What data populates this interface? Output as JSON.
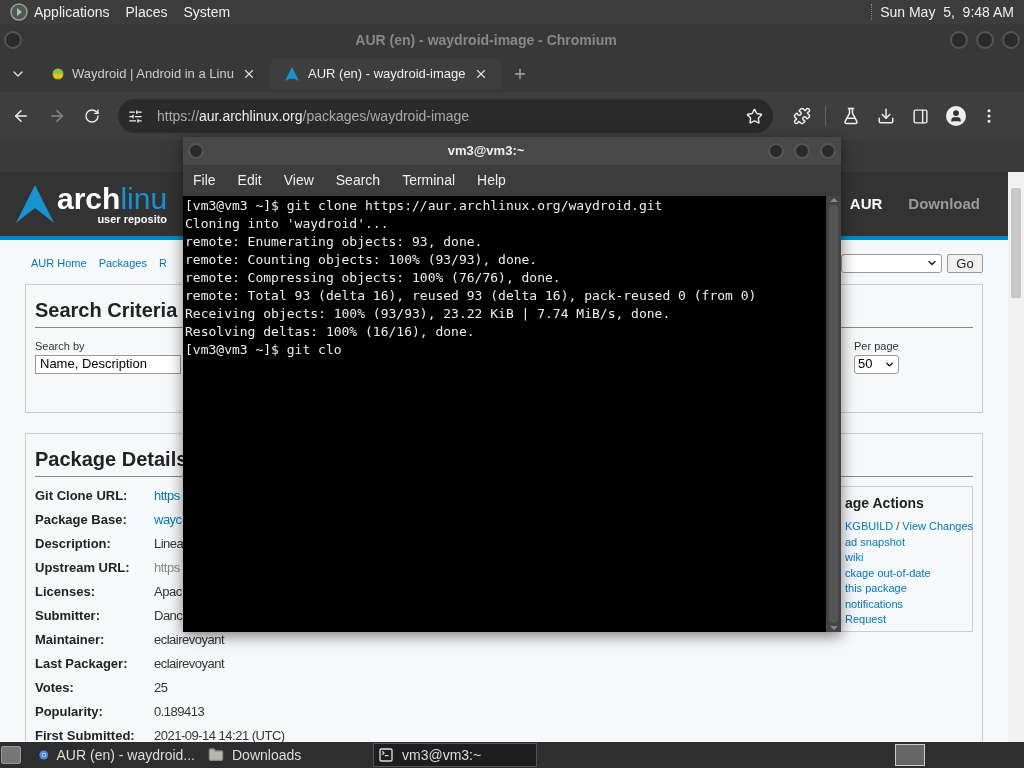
{
  "top_panel": {
    "menus": [
      "Applications",
      "Places",
      "System"
    ],
    "clock": "Sun May  5,  9:48 AM"
  },
  "browser": {
    "title": "AUR (en) - waydroid-image - Chromium",
    "tabs": [
      {
        "label": "Waydroid | Android in a Linu",
        "selected": false
      },
      {
        "label": "AUR (en) - waydroid-image",
        "selected": true
      }
    ],
    "url": {
      "scheme": "https://",
      "host": "aur.archlinux.org",
      "path": "/packages/waydroid-image"
    }
  },
  "page": {
    "logo": {
      "arch": "arch",
      "linux": "linu",
      "subtitle": "user reposito"
    },
    "header_nav": [
      {
        "label": "AUR",
        "selected": true
      },
      {
        "label": "Download",
        "selected": false
      }
    ],
    "nav": [
      "AUR Home",
      "Packages",
      "R"
    ],
    "search": {
      "title": "Search Criteria",
      "search_by_label": "Search by",
      "search_by_value": "Name, Description",
      "per_page_label": "Per page",
      "per_page_value": "50",
      "go": "Go"
    },
    "details": {
      "title": "Package Details",
      "rows": [
        {
          "label": "Git Clone URL:",
          "value": "https",
          "kind": "link"
        },
        {
          "label": "Package Base:",
          "value": "wayc",
          "kind": "link"
        },
        {
          "label": "Description:",
          "value": "Linea",
          "kind": "text"
        },
        {
          "label": "Upstream URL:",
          "value": "https",
          "kind": "muted"
        },
        {
          "label": "Licenses:",
          "value": "Apac",
          "kind": "text"
        },
        {
          "label": "Submitter:",
          "value": "Danc",
          "kind": "text"
        },
        {
          "label": "Maintainer:",
          "value": "eclairevoyant",
          "kind": "text"
        },
        {
          "label": "Last Packager:",
          "value": "eclairevoyant",
          "kind": "text"
        },
        {
          "label": "Votes:",
          "value": "25",
          "kind": "text"
        },
        {
          "label": "Popularity:",
          "value": "0.189413",
          "kind": "text"
        },
        {
          "label": "First Submitted:",
          "value": "2021-09-14 14:21 (UTC)",
          "kind": "text"
        }
      ]
    },
    "actions": {
      "title": "age Actions",
      "lines": [
        [
          {
            "text": "KGBUILD",
            "kind": "link"
          },
          {
            "text": "/",
            "kind": "plain"
          },
          {
            "text": "View Changes",
            "kind": "link"
          }
        ],
        [
          {
            "text": "ad snapshot",
            "kind": "link"
          }
        ],
        [
          {
            "text": "wiki",
            "kind": "link"
          }
        ],
        [
          {
            "text": "ckage out-of-date",
            "kind": "link"
          }
        ],
        [
          {
            "text": "this package",
            "kind": "link"
          }
        ],
        [
          {
            "text": "notifications",
            "kind": "link"
          }
        ],
        [
          {
            "text": "Request",
            "kind": "link"
          }
        ]
      ]
    }
  },
  "terminal": {
    "title": "vm3@vm3:~",
    "menus": [
      "File",
      "Edit",
      "View",
      "Search",
      "Terminal",
      "Help"
    ],
    "lines": [
      "[vm3@vm3 ~]$ git clone https://aur.archlinux.org/waydroid.git",
      "Cloning into 'waydroid'...",
      "remote: Enumerating objects: 93, done.",
      "remote: Counting objects: 100% (93/93), done.",
      "remote: Compressing objects: 100% (76/76), done.",
      "remote: Total 93 (delta 16), reused 93 (delta 16), pack-reused 0 (from 0)",
      "Receiving objects: 100% (93/93), 23.22 KiB | 7.74 MiB/s, done.",
      "Resolving deltas: 100% (16/16), done.",
      "[vm3@vm3 ~]$ git clo"
    ]
  },
  "taskbar": {
    "items": [
      {
        "label": "AUR (en) - waydroid...",
        "selected": false
      },
      {
        "label": "Downloads",
        "selected": false
      },
      {
        "label": "vm3@vm3:~",
        "selected": true
      }
    ]
  }
}
